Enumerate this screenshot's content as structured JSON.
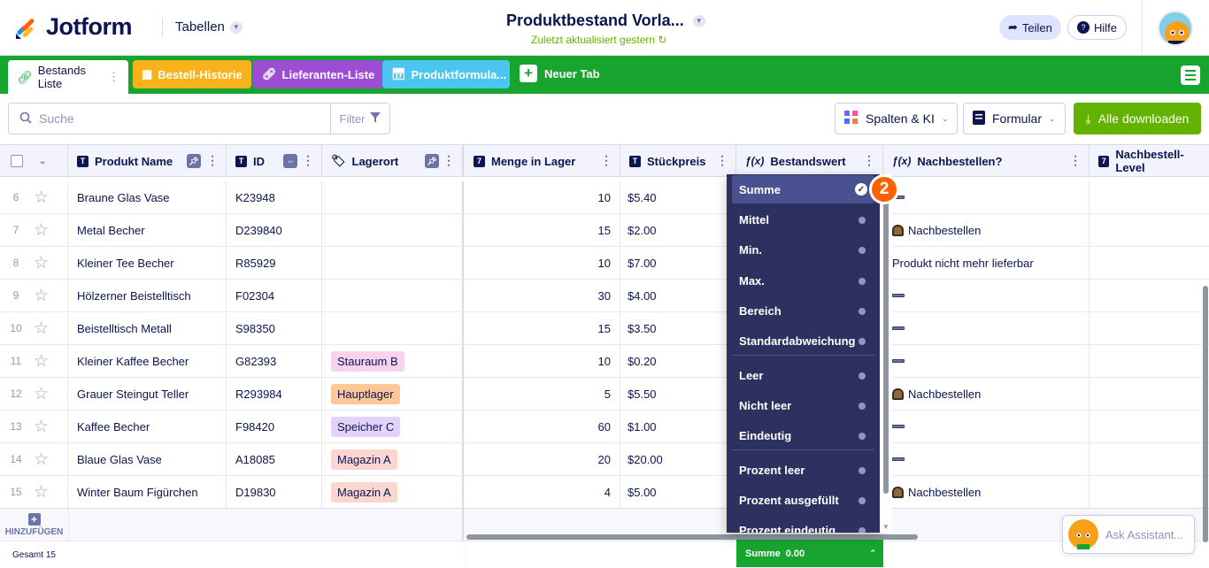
{
  "brand": {
    "name": "Jotform"
  },
  "header": {
    "tables_label": "Tabellen",
    "title": "Produktbestand Vorla...",
    "subtitle": "Zuletzt aktualisiert gestern",
    "share_label": "Teilen",
    "help_label": "Hilfe"
  },
  "tabs": [
    {
      "label": "Bestands Liste",
      "color": "#ffffff"
    },
    {
      "label": "Bestell-Historie",
      "color": "#f9b21b"
    },
    {
      "label": "Lieferanten-Liste",
      "color": "#9c4dd3"
    },
    {
      "label": "Produktformula...",
      "color": "#4cc6f0"
    }
  ],
  "new_tab_label": "Neuer Tab",
  "toolbar": {
    "search_placeholder": "Suche",
    "filter_label": "Filter",
    "columns_ai_label": "Spalten & KI",
    "form_label": "Formular",
    "download_label": "Alle downloaden"
  },
  "columns": [
    {
      "label": "Produkt Name",
      "icon": "T"
    },
    {
      "label": "ID",
      "icon": "T"
    },
    {
      "label": "Lagerort",
      "icon": "tag"
    },
    {
      "label": "Menge in Lager",
      "icon": "7"
    },
    {
      "label": "Stückpreis",
      "icon": "T"
    },
    {
      "label": "Bestandswert",
      "icon": "f(x)"
    },
    {
      "label": "Nachbestellen?",
      "icon": "f(x)"
    },
    {
      "label": "Nachbestell-Level",
      "icon": "7"
    }
  ],
  "rows": [
    {
      "n": "6",
      "name": "Braune Glas Vase",
      "id": "K23948",
      "loc": "",
      "qty": "10",
      "price": "$5.40",
      "reorder": "dash"
    },
    {
      "n": "7",
      "name": "Metal Becher",
      "id": "D239840",
      "loc": "",
      "qty": "15",
      "price": "$2.00",
      "reorder": "Nachbestellen"
    },
    {
      "n": "8",
      "name": "Kleiner Tee Becher",
      "id": "R85929",
      "loc": "",
      "qty": "10",
      "price": "$7.00",
      "reorder": "Produkt nicht mehr lieferbar"
    },
    {
      "n": "9",
      "name": "Hölzerner Beistelltisch",
      "id": "F02304",
      "loc": "",
      "qty": "30",
      "price": "$4.00",
      "reorder": "dash"
    },
    {
      "n": "10",
      "name": "Beistelltisch Metall",
      "id": "S98350",
      "loc": "",
      "qty": "15",
      "price": "$3.50",
      "reorder": "dash"
    },
    {
      "n": "11",
      "name": "Kleiner Kaffee Becher",
      "id": "G82393",
      "loc": "Stauraum B",
      "loc_color": "#f8d3ee",
      "qty": "10",
      "price": "$0.20",
      "reorder": "dash"
    },
    {
      "n": "12",
      "name": "Grauer Steingut Teller",
      "id": "R293984",
      "loc": "Hauptlager",
      "loc_color": "#fcc89a",
      "qty": "5",
      "price": "$5.50",
      "reorder": "Nachbestellen"
    },
    {
      "n": "13",
      "name": "Kaffee Becher",
      "id": "F98420",
      "loc": "Speicher C",
      "loc_color": "#e3d3fb",
      "qty": "60",
      "price": "$1.00",
      "reorder": "dash"
    },
    {
      "n": "14",
      "name": "Blaue Glas Vase",
      "id": "A18085",
      "loc": "Magazin A",
      "loc_color": "#fcd6cf",
      "qty": "20",
      "price": "$20.00",
      "reorder": "dash"
    },
    {
      "n": "15",
      "name": "Winter Baum Figürchen",
      "id": "D19830",
      "loc": "Magazin A",
      "loc_color": "#fcd6cf",
      "qty": "4",
      "price": "$5.00",
      "reorder": "Nachbestellen"
    }
  ],
  "footer": {
    "add_label": "HINZUFÜGEN",
    "total_label": "Gesamt 15",
    "sum_label": "Summe",
    "sum_value": "0.00"
  },
  "dropdown": {
    "items": [
      "Summe",
      "Mittel",
      "Min.",
      "Max.",
      "Bereich",
      "Standardabweichung",
      "Leer",
      "Nicht leer",
      "Eindeutig",
      "Prozent leer",
      "Prozent ausgefüllt",
      "Prozent eindeutig"
    ],
    "selected": "Summe",
    "step_badge": "2"
  },
  "assistant": {
    "label": "Ask Assistant..."
  }
}
